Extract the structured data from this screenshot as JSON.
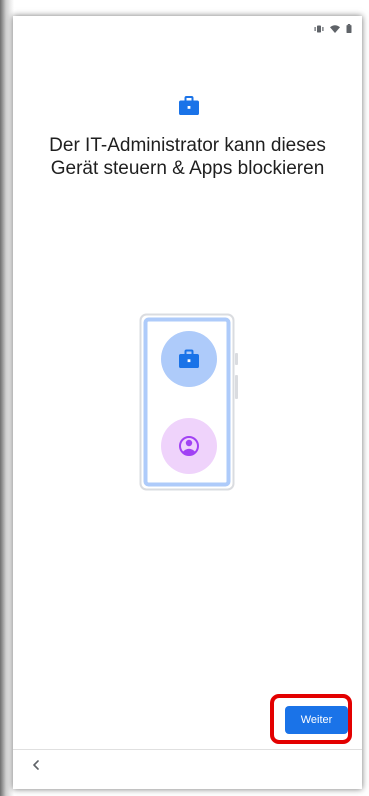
{
  "status_bar": {
    "icons": [
      "vibrate-icon",
      "wifi-icon",
      "battery-icon"
    ]
  },
  "setup": {
    "header_icon": "work-briefcase-icon",
    "title": "Der IT-Administrator kann dieses Gerät steuern & Apps blockieren",
    "illustration": {
      "top_icon": "work-briefcase-icon",
      "bottom_icon": "personal-profile-icon"
    }
  },
  "footer": {
    "next_label": "Weiter",
    "back_icon": "chevron-left-icon"
  },
  "colors": {
    "accent": "#1a73e8",
    "work_circle": "#aecbfa",
    "personal_circle": "#efd3fb",
    "personal_icon": "#a142f4",
    "highlight": "#e30000"
  }
}
